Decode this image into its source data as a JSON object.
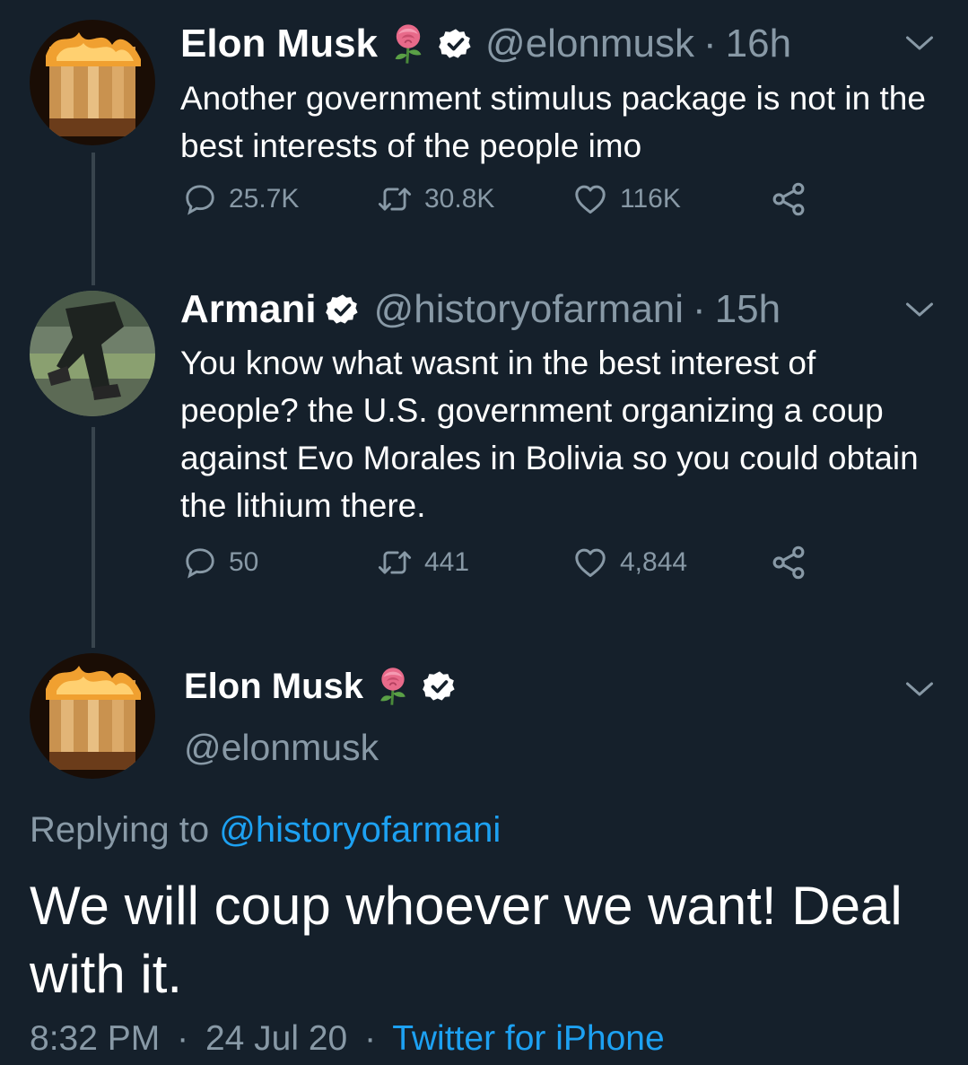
{
  "tweet1": {
    "name": "Elon Musk",
    "handle": "@elonmusk",
    "separator": "·",
    "time": "16h",
    "text": "Another government stimulus package is not in the best interests of the people imo",
    "replies": "25.7K",
    "retweets": "30.8K",
    "likes": "116K"
  },
  "tweet2": {
    "name": "Armani",
    "handle": "@historyofarmani",
    "separator": "·",
    "time": "15h",
    "text": "You know what wasnt in the best interest of people? the U.S. government organizing a coup against Evo Morales in Bolivia so you could obtain the lithium there.",
    "replies": "50",
    "retweets": "441",
    "likes": "4,844"
  },
  "focal": {
    "name": "Elon Musk",
    "handle": "@elonmusk",
    "replying_prefix": "Replying to ",
    "replying_handle": "@historyofarmani",
    "text": "We will coup whoever we want! Deal with it.",
    "time": "8:32 PM",
    "separator1": "·",
    "date": "24 Jul 20",
    "separator2": "·",
    "source": "Twitter for iPhone"
  },
  "icons": {
    "reply": "reply-icon",
    "retweet": "retweet-icon",
    "like": "heart-icon",
    "share": "share-icon",
    "verified": "verified-badge-icon",
    "rose": "rose-emoji-icon",
    "chevron": "chevron-down-icon"
  },
  "colors": {
    "background": "#15202b",
    "secondary_text": "#8899a6",
    "link": "#1da1f2",
    "thread_line": "#38444d"
  }
}
